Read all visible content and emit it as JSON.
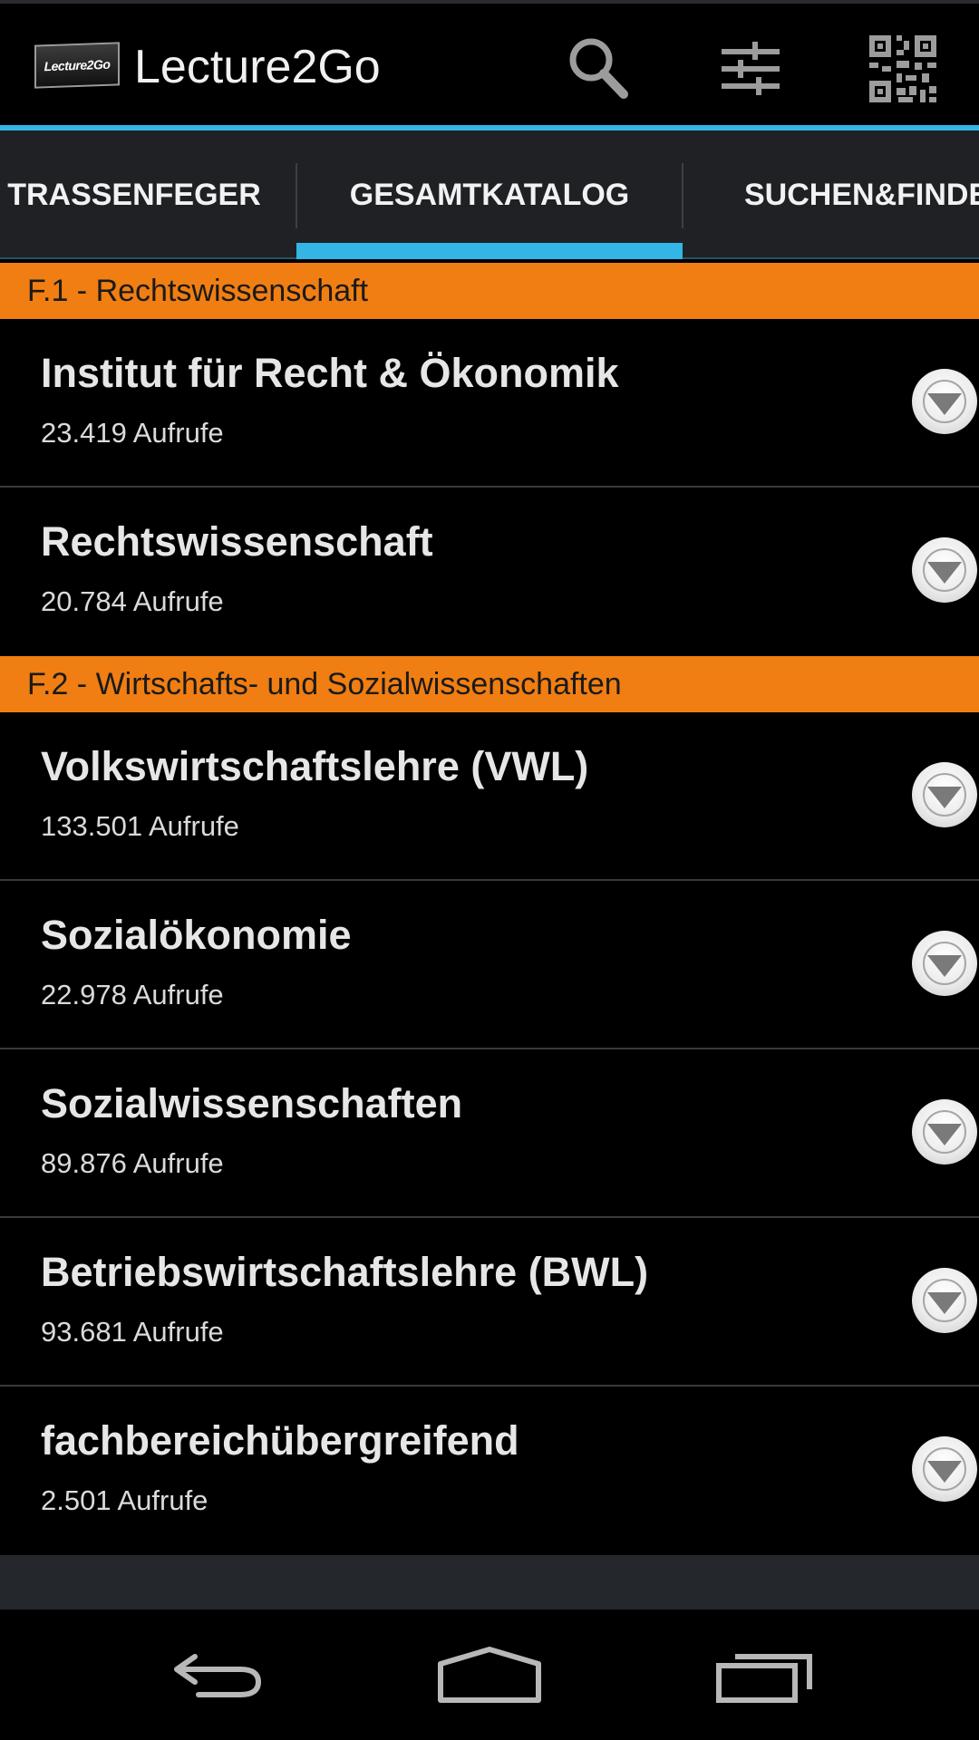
{
  "app": {
    "title": "Lecture2Go",
    "logo_text": "Lecture2Go"
  },
  "actionbar": {
    "icons": [
      "search-icon",
      "settings-sliders-icon",
      "qr-code-icon"
    ]
  },
  "tabs": [
    {
      "label": "TRASSENFEGER",
      "selected": false
    },
    {
      "label": "GESAMTKATALOG",
      "selected": true
    },
    {
      "label": "SUCHEN&FINDE",
      "selected": false
    }
  ],
  "sections": [
    {
      "header": "F.1 - Rechtswissenschaft",
      "items": [
        {
          "title": "Institut für Recht & Ökonomik",
          "views": "23.419 Aufrufe"
        },
        {
          "title": "Rechtswissenschaft",
          "views": "20.784 Aufrufe"
        }
      ]
    },
    {
      "header": "F.2 - Wirtschafts- und Sozialwissenschaften",
      "items": [
        {
          "title": "Volkswirtschaftslehre (VWL)",
          "views": "133.501 Aufrufe"
        },
        {
          "title": "Sozialökonomie",
          "views": "22.978 Aufrufe"
        },
        {
          "title": "Sozialwissenschaften",
          "views": "89.876 Aufrufe"
        },
        {
          "title": "Betriebswirtschaftslehre (BWL)",
          "views": "93.681 Aufrufe"
        },
        {
          "title": "fachbereichübergreifend",
          "views": "2.501 Aufrufe"
        }
      ]
    }
  ],
  "colors": {
    "accent": "#33b5e5",
    "section_header": "#f07e12",
    "background": "#000000"
  },
  "navbar": {
    "icons": [
      "back-icon",
      "home-icon",
      "recent-apps-icon"
    ]
  }
}
